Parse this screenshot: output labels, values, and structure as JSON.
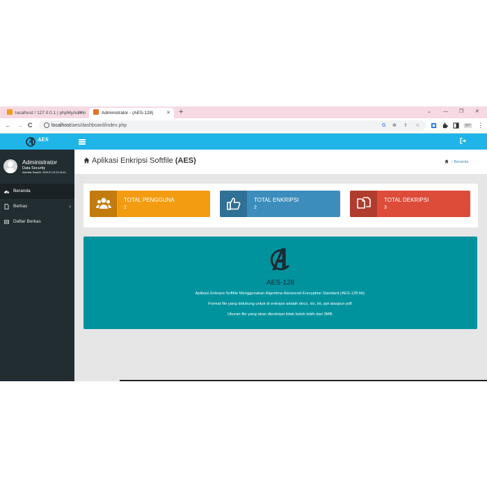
{
  "browser": {
    "tabs": [
      {
        "title": "localhost / 127.0.0.1 | phpMyAdmin",
        "active": false
      },
      {
        "title": "Administrator - (AES-128)",
        "active": true
      }
    ],
    "url_host": "localhost",
    "url_path": "/aes/dashboard/index.php",
    "new_tab_label": "+",
    "window_controls": [
      "⌄",
      "—",
      "❐",
      "✕"
    ],
    "nav": {
      "back": "←",
      "forward": "→",
      "reload": "C"
    }
  },
  "header": {
    "logo_text": "AES",
    "menu_toggle": "sidebar-toggle",
    "signout": "sign-out-icon"
  },
  "sidebar": {
    "user": {
      "name": "Administrator",
      "role": "Data Security",
      "last_active": "Aktivitas Terakhir: 2023-07-24 21:24:43"
    },
    "items": [
      {
        "label": "Beranda",
        "icon": "dashboard-icon",
        "active": true
      },
      {
        "label": "Berkas",
        "icon": "file-icon",
        "active": false,
        "chevron": "›"
      },
      {
        "label": "Daftar Berkas",
        "icon": "list-icon",
        "active": false
      }
    ]
  },
  "page": {
    "title_prefix": "Aplikasi Enkripsi Softfile",
    "title_bold": "(AES)",
    "breadcrumb": "Beranda"
  },
  "stats": [
    {
      "label": "TOTAL PENGGUNA",
      "value": "2",
      "color": "#f39c12",
      "icon": "users-icon"
    },
    {
      "label": "TOTAL ENKRIPSI",
      "value": "2",
      "color": "#3c8dbc",
      "icon": "thumbs-up-icon"
    },
    {
      "label": "TOTAL DEKRIPSI",
      "value": "3",
      "color": "#dd4b39",
      "icon": "copy-icon"
    }
  ],
  "hero": {
    "title": "AES-128",
    "line1": "Aplikasi Enkripsi Softfile Menggunakan Algoritma Advanced Encryption Standard (AES-128 bit).",
    "line2": "Format file yang didukung untuk di enkripsi adalah docx, xls, txt, ppt ataupun pdf.",
    "line3": "Ukuran file yang akan dienkripsi tidak boleh lebih dari 3MB.",
    "color": "#00939e"
  }
}
